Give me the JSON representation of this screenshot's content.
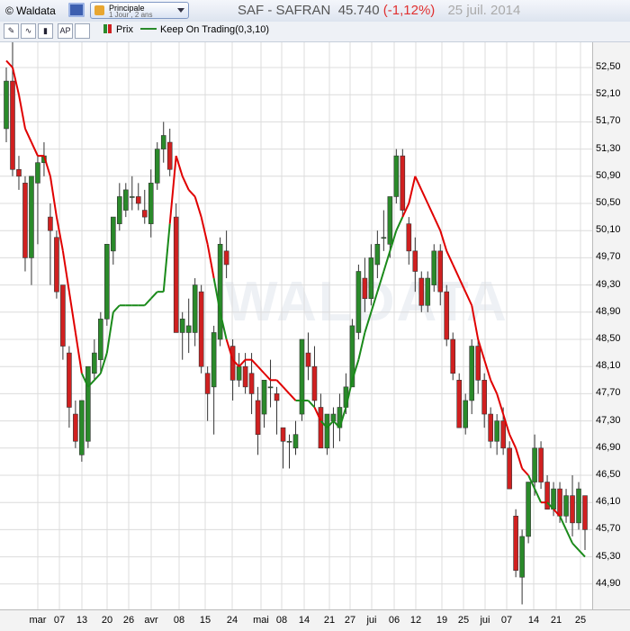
{
  "app": {
    "title": "© Waldata",
    "preset": {
      "line1": "Principale",
      "line2": "1 Jour , 2 ans"
    }
  },
  "header": {
    "symbol": "SAF - SAFRAN",
    "price": "45.740",
    "change": "(-1,12%)",
    "date": "25 juil. 2014"
  },
  "toolbar": {
    "buttons": [
      {
        "name": "tools-icon",
        "glyph": "✎"
      },
      {
        "name": "line-chart-icon",
        "glyph": "∿"
      },
      {
        "name": "candle-chart-icon",
        "glyph": "▮"
      },
      {
        "name": "ap-icon",
        "glyph": "AP"
      },
      {
        "name": "blank-icon",
        "glyph": ""
      }
    ]
  },
  "legend": {
    "price_label": "Prix",
    "indicator_label": "Keep On Trading(0,3,10)"
  },
  "watermark": "WALDATA",
  "colors": {
    "up": "#2a8a2a",
    "down": "#d02020",
    "stop_down": "#e00000",
    "stop_up": "#1a8a1a",
    "grid": "#dcdcdc"
  },
  "chart_data": {
    "type": "candlestick",
    "y_ticks": [
      "52,50",
      "52,10",
      "51,70",
      "51,30",
      "50,90",
      "50,50",
      "50,10",
      "49,70",
      "49,30",
      "48,90",
      "48,50",
      "48,10",
      "47,70",
      "47,30",
      "46,90",
      "46,50",
      "46,10",
      "45,70",
      "45,30",
      "44,90"
    ],
    "ylim": [
      44.6,
      52.8
    ],
    "x_ticks": [
      "mar",
      "07",
      "13",
      "20",
      "26",
      "avr",
      "08",
      "15",
      "24",
      "mai",
      "08",
      "14",
      "21",
      "27",
      "jui",
      "06",
      "12",
      "19",
      "25",
      "jui",
      "07",
      "14",
      "21",
      "25"
    ],
    "series": [
      {
        "name": "Prix",
        "ohlc": [
          [
            51.6,
            52.5,
            51.4,
            52.3
          ],
          [
            52.3,
            52.9,
            50.9,
            51.0
          ],
          [
            51.0,
            51.2,
            50.7,
            50.9
          ],
          [
            50.8,
            50.9,
            49.5,
            49.7
          ],
          [
            49.7,
            50.9,
            49.3,
            50.9
          ],
          [
            50.8,
            51.2,
            49.9,
            51.1
          ],
          [
            51.1,
            51.4,
            50.9,
            51.2
          ],
          [
            50.3,
            50.5,
            49.3,
            50.1
          ],
          [
            50.0,
            50.1,
            49.1,
            49.2
          ],
          [
            49.3,
            49.3,
            48.2,
            48.4
          ],
          [
            48.3,
            48.4,
            47.2,
            47.5
          ],
          [
            47.4,
            47.6,
            46.9,
            47.0
          ],
          [
            46.8,
            47.6,
            46.7,
            47.6
          ],
          [
            47.0,
            48.1,
            46.9,
            48.1
          ],
          [
            48.0,
            48.5,
            47.9,
            48.3
          ],
          [
            48.2,
            48.9,
            48.0,
            48.8
          ],
          [
            48.8,
            49.9,
            48.7,
            49.9
          ],
          [
            49.8,
            50.3,
            49.6,
            50.3
          ],
          [
            50.2,
            50.8,
            50.1,
            50.6
          ],
          [
            50.4,
            50.8,
            50.3,
            50.7
          ],
          [
            50.6,
            50.9,
            50.4,
            50.6
          ],
          [
            50.6,
            50.8,
            50.4,
            50.5
          ],
          [
            50.4,
            50.7,
            50.2,
            50.3
          ],
          [
            50.2,
            51.0,
            50.0,
            50.8
          ],
          [
            50.8,
            51.4,
            50.7,
            51.3
          ],
          [
            51.3,
            51.7,
            51.1,
            51.5
          ],
          [
            51.4,
            51.6,
            50.9,
            51.0
          ],
          [
            50.3,
            50.5,
            48.6,
            48.6
          ],
          [
            48.6,
            48.9,
            48.2,
            48.8
          ],
          [
            48.6,
            49.1,
            48.3,
            48.7
          ],
          [
            48.6,
            49.4,
            48.4,
            49.3
          ],
          [
            49.2,
            49.3,
            48.0,
            48.1
          ],
          [
            48.0,
            48.1,
            47.3,
            47.7
          ],
          [
            47.8,
            48.7,
            47.1,
            48.6
          ],
          [
            48.5,
            50.0,
            48.4,
            49.9
          ],
          [
            49.8,
            50.1,
            49.4,
            49.6
          ],
          [
            48.4,
            48.5,
            47.6,
            47.9
          ],
          [
            47.9,
            48.3,
            47.8,
            48.1
          ],
          [
            48.1,
            48.3,
            47.7,
            47.8
          ],
          [
            48.0,
            48.3,
            47.4,
            47.7
          ],
          [
            47.6,
            47.8,
            46.8,
            47.1
          ],
          [
            47.4,
            47.9,
            47.2,
            47.9
          ],
          [
            47.8,
            48.2,
            47.5,
            47.8
          ],
          [
            47.7,
            47.8,
            47.1,
            47.6
          ],
          [
            47.2,
            47.2,
            46.6,
            47.0
          ],
          [
            47.0,
            47.1,
            46.6,
            47.0
          ],
          [
            46.9,
            47.3,
            46.8,
            47.1
          ],
          [
            47.4,
            48.5,
            47.3,
            48.5
          ],
          [
            48.3,
            48.6,
            47.9,
            48.1
          ],
          [
            48.1,
            48.4,
            47.5,
            47.6
          ],
          [
            47.5,
            47.7,
            46.9,
            46.9
          ],
          [
            46.9,
            47.4,
            46.8,
            47.4
          ],
          [
            47.3,
            47.5,
            46.9,
            47.4
          ],
          [
            47.2,
            47.7,
            47.0,
            47.5
          ],
          [
            47.5,
            48.0,
            47.4,
            47.8
          ],
          [
            47.8,
            48.8,
            47.8,
            48.7
          ],
          [
            48.6,
            49.6,
            48.5,
            49.5
          ],
          [
            49.4,
            49.7,
            48.9,
            49.1
          ],
          [
            49.1,
            49.9,
            49.0,
            49.7
          ],
          [
            49.6,
            50.1,
            49.4,
            49.9
          ],
          [
            50.0,
            50.4,
            49.8,
            50.0
          ],
          [
            49.9,
            50.6,
            49.7,
            50.6
          ],
          [
            50.6,
            51.3,
            50.5,
            51.2
          ],
          [
            51.2,
            51.3,
            50.3,
            50.4
          ],
          [
            50.2,
            50.3,
            49.6,
            49.8
          ],
          [
            49.8,
            50.0,
            49.2,
            49.5
          ],
          [
            49.4,
            49.5,
            48.9,
            49.0
          ],
          [
            49.0,
            49.5,
            48.9,
            49.4
          ],
          [
            49.3,
            49.9,
            49.2,
            49.8
          ],
          [
            49.8,
            49.9,
            49.0,
            49.2
          ],
          [
            49.2,
            49.3,
            48.4,
            48.5
          ],
          [
            48.5,
            48.6,
            47.9,
            48.0
          ],
          [
            47.9,
            48.0,
            47.2,
            47.2
          ],
          [
            47.2,
            47.7,
            47.1,
            47.6
          ],
          [
            47.6,
            48.5,
            47.4,
            48.4
          ],
          [
            48.4,
            48.5,
            47.7,
            47.9
          ],
          [
            47.9,
            48.0,
            47.2,
            47.4
          ],
          [
            47.4,
            47.5,
            46.9,
            47.0
          ],
          [
            47.0,
            47.4,
            46.8,
            47.3
          ],
          [
            47.3,
            47.5,
            46.8,
            46.9
          ],
          [
            46.9,
            47.0,
            46.3,
            46.3
          ],
          [
            45.9,
            46.0,
            45.0,
            45.1
          ],
          [
            45.0,
            45.7,
            44.6,
            45.6
          ],
          [
            45.6,
            46.4,
            45.5,
            46.4
          ],
          [
            46.4,
            47.1,
            46.2,
            46.9
          ],
          [
            46.9,
            47.0,
            46.3,
            46.4
          ],
          [
            46.4,
            46.5,
            46.0,
            46.0
          ],
          [
            46.0,
            46.4,
            45.9,
            46.3
          ],
          [
            46.3,
            46.4,
            45.8,
            45.9
          ],
          [
            45.9,
            46.3,
            45.8,
            46.2
          ],
          [
            46.2,
            46.5,
            45.6,
            45.8
          ],
          [
            45.8,
            46.4,
            45.7,
            46.3
          ],
          [
            46.2,
            46.2,
            45.4,
            45.7
          ]
        ]
      },
      {
        "name": "Keep On Trading(0,3,10)",
        "values": [
          52.6,
          52.5,
          52.1,
          51.6,
          51.4,
          51.2,
          51.2,
          50.9,
          50.3,
          49.8,
          49.2,
          48.6,
          48.0,
          47.8,
          47.9,
          48.0,
          48.3,
          48.9,
          49.0,
          49.0,
          49.0,
          49.0,
          49.0,
          49.1,
          49.2,
          49.2,
          50.2,
          51.2,
          50.9,
          50.7,
          50.6,
          50.3,
          49.9,
          49.4,
          48.9,
          48.5,
          48.2,
          48.1,
          48.2,
          48.2,
          48.1,
          48.0,
          47.9,
          47.9,
          47.8,
          47.7,
          47.6,
          47.6,
          47.6,
          47.5,
          47.3,
          47.2,
          47.3,
          47.2,
          47.5,
          47.9,
          48.2,
          48.6,
          48.9,
          49.2,
          49.5,
          49.8,
          50.1,
          50.3,
          50.5,
          50.9,
          50.7,
          50.5,
          50.3,
          50.1,
          49.8,
          49.6,
          49.4,
          49.2,
          49.0,
          48.5,
          48.2,
          47.9,
          47.7,
          47.4,
          47.1,
          46.9,
          46.6,
          46.5,
          46.3,
          46.1,
          46.1,
          46.0,
          45.9,
          45.7,
          45.5,
          45.4,
          45.3,
          45.2,
          45.1
        ]
      }
    ]
  }
}
